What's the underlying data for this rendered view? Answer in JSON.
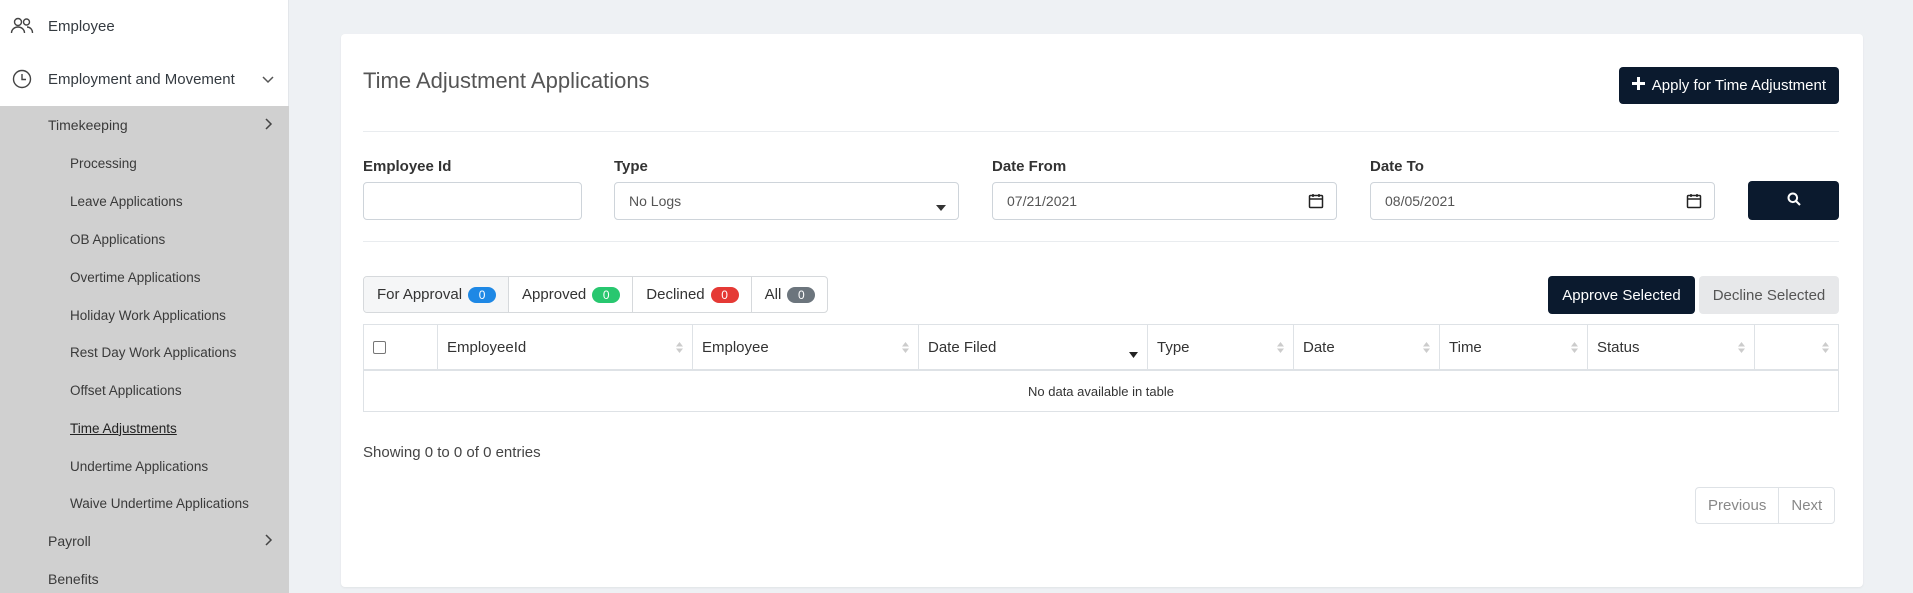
{
  "sidebar": {
    "top_items": [
      {
        "label": "Employee",
        "icon": "users-icon"
      },
      {
        "label": "Employment and Movement",
        "icon": "clock-icon"
      }
    ],
    "sub_items": [
      {
        "label": "Timekeeping",
        "level": 1,
        "has_chevron": true
      },
      {
        "label": "Processing",
        "level": 2
      },
      {
        "label": "Leave Applications",
        "level": 2
      },
      {
        "label": "OB Applications",
        "level": 2
      },
      {
        "label": "Overtime Applications",
        "level": 2
      },
      {
        "label": "Holiday Work Applications",
        "level": 2
      },
      {
        "label": "Rest Day Work Applications",
        "level": 2
      },
      {
        "label": "Offset Applications",
        "level": 2
      },
      {
        "label": "Time Adjustments",
        "level": 2,
        "active": true
      },
      {
        "label": "Undertime Applications",
        "level": 2
      },
      {
        "label": "Waive Undertime Applications",
        "level": 2
      },
      {
        "label": "Payroll",
        "level": 1,
        "has_chevron": true
      },
      {
        "label": "Benefits",
        "level": 1
      }
    ]
  },
  "main": {
    "title": "Time Adjustment Applications",
    "apply_button": "Apply for Time Adjustment",
    "filters": {
      "employee_id_label": "Employee Id",
      "employee_id_value": "",
      "type_label": "Type",
      "type_value": "No Logs",
      "date_from_label": "Date From",
      "date_from_value": "07/21/2021",
      "date_to_label": "Date To",
      "date_to_value": "08/05/2021"
    },
    "tabs": [
      {
        "label": "For Approval",
        "count": "0",
        "color": "#1e88e5"
      },
      {
        "label": "Approved",
        "count": "0",
        "color": "#28c76f"
      },
      {
        "label": "Declined",
        "count": "0",
        "color": "#e53935"
      },
      {
        "label": "All",
        "count": "0",
        "color": "#6c757d"
      }
    ],
    "approve_selected": "Approve Selected",
    "decline_selected": "Decline Selected",
    "table": {
      "columns": [
        "",
        "EmployeeId",
        "Employee",
        "Date Filed",
        "Type",
        "Date",
        "Time",
        "Status",
        ""
      ],
      "empty_text": "No data available in table"
    },
    "info_text": "Showing 0 to 0 of 0 entries",
    "pagination": {
      "previous": "Previous",
      "next": "Next"
    }
  },
  "colors": {
    "primary_dark": "#0b1a2e",
    "sidebar_sub_bg": "#d0d0d0",
    "page_bg": "#eef1f4"
  }
}
